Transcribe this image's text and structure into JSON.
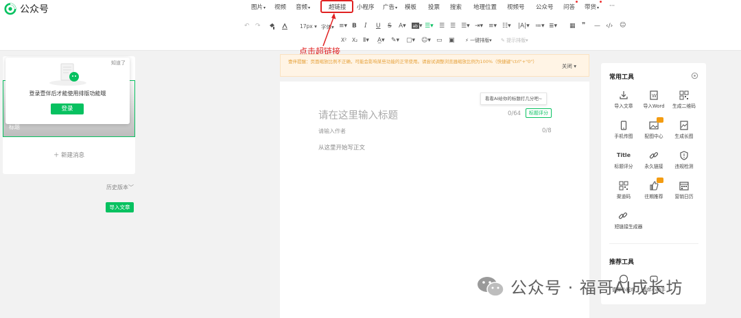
{
  "brand": {
    "name": "公众号"
  },
  "menu": {
    "items": [
      {
        "label": "图片",
        "caret": true
      },
      {
        "label": "视频",
        "caret": false
      },
      {
        "label": "音频",
        "caret": true
      },
      {
        "label": "超链接",
        "caret": false
      },
      {
        "label": "小程序",
        "caret": false
      },
      {
        "label": "广告",
        "caret": true
      },
      {
        "label": "模板",
        "caret": false
      },
      {
        "label": "投票",
        "caret": false
      },
      {
        "label": "搜索",
        "caret": false
      },
      {
        "label": "地理位置",
        "caret": false
      },
      {
        "label": "视频号",
        "caret": false
      },
      {
        "label": "公众号",
        "caret": false
      },
      {
        "label": "问答",
        "caret": false
      },
      {
        "label": "带货",
        "caret": true
      },
      {
        "label": "···",
        "caret": false
      }
    ]
  },
  "toolbar": {
    "font_size": "17px",
    "font_family": "字体",
    "letter_a": "A",
    "bold": "B",
    "italic": "I",
    "underline": "U",
    "strike": "S",
    "superscript": "X²",
    "subscript": "X₂",
    "one_click_format": "一键排版",
    "format_more": "提示排版"
  },
  "annotation": {
    "text": "点击超链接",
    "color": "#e02020"
  },
  "left": {
    "login_tip": "知道了",
    "login_message": "登录壹伴后才能使用排版功能哦",
    "login_button": "登录",
    "card_label": "标题",
    "new_message": "新建消息",
    "history": "历史版本",
    "import_button": "导入文章"
  },
  "notice": {
    "text": "壹伴提醒：页面缩放比例不正确，可能会影响某些功能的正常使用。请尝试调整浏览器缩放比例为100%（快捷键\"ctrl\"+\"0\"）",
    "close": "关闭"
  },
  "editor": {
    "ai_tip": "看看AI给你的标题打几分吧~",
    "title_placeholder": "请在这里输入标题",
    "title_count": "0/64",
    "title_score": "标题评分",
    "author_placeholder": "请输入作者",
    "author_count": "0/8",
    "body_placeholder": "从这里开始写正文"
  },
  "right": {
    "common_title": "常用工具",
    "recommend_title": "推荐工具",
    "tools": [
      {
        "label": "导入文章",
        "icon": "import-icon",
        "badge": false
      },
      {
        "label": "导入Word",
        "icon": "word-icon",
        "badge": false
      },
      {
        "label": "生成二维码",
        "icon": "qrcode-icon",
        "badge": false
      },
      {
        "label": "手机传图",
        "icon": "phone-icon",
        "badge": false
      },
      {
        "label": "配图中心",
        "icon": "image-icon",
        "badge": true
      },
      {
        "label": "生成长图",
        "icon": "long-image-icon",
        "badge": false
      },
      {
        "label": "标题评分",
        "icon": "title-icon",
        "badge": false,
        "icon_text": "Title"
      },
      {
        "label": "永久链接",
        "icon": "link-icon",
        "badge": false
      },
      {
        "label": "违规检测",
        "icon": "shield-icon",
        "badge": false
      },
      {
        "label": "渠道码",
        "icon": "qrcode-icon",
        "badge": false
      },
      {
        "label": "往期推荐",
        "icon": "thumb-icon",
        "badge": true
      },
      {
        "label": "营销日历",
        "icon": "calendar-icon",
        "badge": false
      },
      {
        "label": "短链接生成器",
        "icon": "link-icon",
        "badge": false
      }
    ],
    "recommend": [
      {
        "label": "壹伴小程序"
      },
      {
        "label": "壹伴小助手"
      }
    ]
  },
  "watermark": {
    "text": "公众号 · 福哥AI成长坊"
  },
  "colors": {
    "brand_green": "#07c160",
    "annotation_red": "#e02020",
    "notice_bg": "#fff4e5",
    "notice_text": "#e6a13a"
  }
}
